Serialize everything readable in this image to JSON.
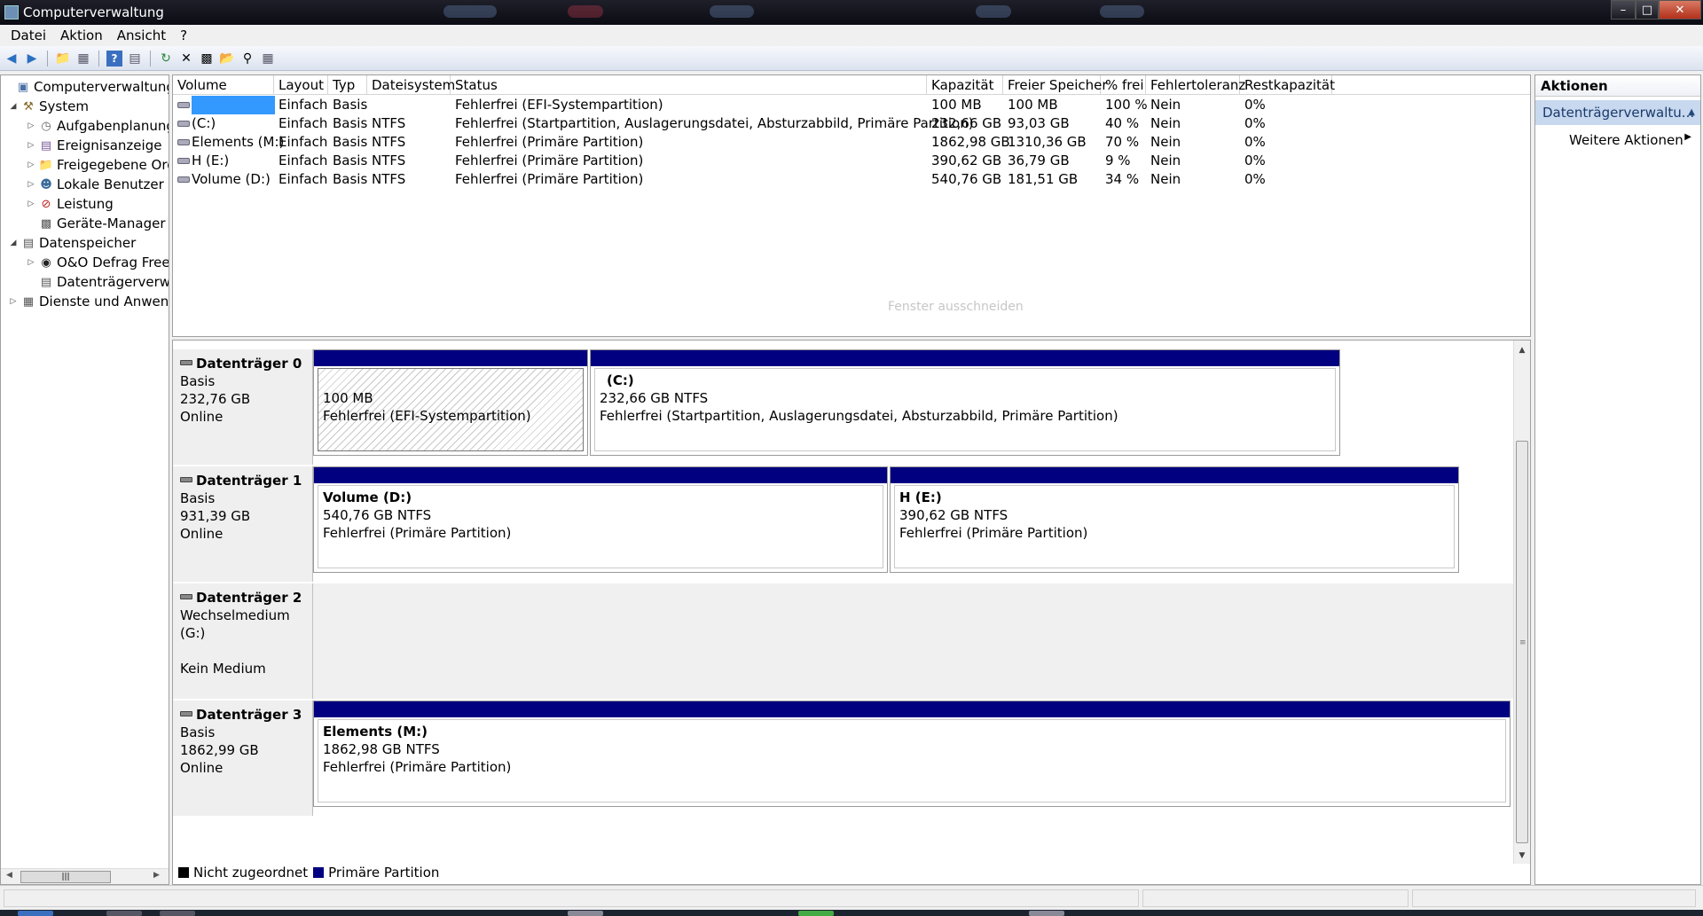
{
  "window": {
    "title": "Computerverwaltung",
    "controls": {
      "minimize": "–",
      "maximize": "□",
      "close": "✕"
    }
  },
  "menu": {
    "items": [
      "Datei",
      "Aktion",
      "Ansicht",
      "?"
    ]
  },
  "toolbar": {
    "icons": [
      "back-arrow-icon",
      "forward-arrow-icon",
      "up-folder-icon",
      "show-hide-tree-icon",
      "help-icon",
      "console-view-icon",
      "refresh-icon",
      "delete-icon",
      "properties-icon",
      "open-icon",
      "search-icon",
      "rescan-icon"
    ]
  },
  "tree": {
    "items": [
      {
        "label": "Computerverwaltung (Lo",
        "level": 0,
        "expander": "",
        "icon": "computer-management-icon"
      },
      {
        "label": "System",
        "level": 1,
        "expander": "◢",
        "icon": "tools-icon"
      },
      {
        "label": "Aufgabenplanung",
        "level": 2,
        "expander": "▷",
        "icon": "clock-icon"
      },
      {
        "label": "Ereignisanzeige",
        "level": 2,
        "expander": "▷",
        "icon": "event-viewer-icon"
      },
      {
        "label": "Freigegebene Ordn",
        "level": 2,
        "expander": "▷",
        "icon": "shared-folder-icon"
      },
      {
        "label": "Lokale Benutzer un",
        "level": 2,
        "expander": "▷",
        "icon": "users-icon"
      },
      {
        "label": "Leistung",
        "level": 2,
        "expander": "▷",
        "icon": "performance-icon"
      },
      {
        "label": "Geräte-Manager",
        "level": 2,
        "expander": "",
        "icon": "device-manager-icon"
      },
      {
        "label": "Datenspeicher",
        "level": 1,
        "expander": "◢",
        "icon": "storage-icon"
      },
      {
        "label": "O&O Defrag Free E",
        "level": 2,
        "expander": "▷",
        "icon": "defrag-icon"
      },
      {
        "label": "Datenträgerverwal",
        "level": 2,
        "expander": "",
        "icon": "disk-management-icon"
      },
      {
        "label": "Dienste und Anwendu",
        "level": 1,
        "expander": "▷",
        "icon": "services-icon"
      }
    ]
  },
  "volume_list": {
    "columns": [
      "Volume",
      "Layout",
      "Typ",
      "Dateisystem",
      "Status",
      "Kapazität",
      "Freier Speicher",
      "% frei",
      "Fehlertoleranz",
      "Restkapazität"
    ],
    "rows": [
      [
        "",
        "Einfach",
        "Basis",
        "",
        "Fehlerfrei (EFI-Systempartition)",
        "100 MB",
        "100 MB",
        "100 %",
        "Nein",
        "0%"
      ],
      [
        "(C:)",
        "Einfach",
        "Basis",
        "NTFS",
        "Fehlerfrei (Startpartition, Auslagerungsdatei, Absturzabbild, Primäre Partition)",
        "232,66 GB",
        "93,03 GB",
        "40 %",
        "Nein",
        "0%"
      ],
      [
        "Elements (M:)",
        "Einfach",
        "Basis",
        "NTFS",
        "Fehlerfrei (Primäre Partition)",
        "1862,98 GB",
        "1310,36 GB",
        "70 %",
        "Nein",
        "0%"
      ],
      [
        "H (E:)",
        "Einfach",
        "Basis",
        "NTFS",
        "Fehlerfrei (Primäre Partition)",
        "390,62 GB",
        "36,79 GB",
        "9 %",
        "Nein",
        "0%"
      ],
      [
        "Volume (D:)",
        "Einfach",
        "Basis",
        "NTFS",
        "Fehlerfrei (Primäre Partition)",
        "540,76 GB",
        "181,51 GB",
        "34 %",
        "Nein",
        "0%"
      ]
    ],
    "overlay_text": "Fenster ausschneiden"
  },
  "disks": [
    {
      "name": "Datenträger 0",
      "type": "Basis",
      "size": "232,76 GB",
      "state": "Online",
      "partitions": [
        {
          "name": "",
          "size": "100 MB",
          "status": "Fehlerfrei (EFI-Systempartition)",
          "hatched": true
        },
        {
          "name": "(C:)",
          "size": "232,66 GB NTFS",
          "status": "Fehlerfrei (Startpartition, Auslagerungsdatei, Absturzabbild, Primäre Partition)",
          "hatched": false
        }
      ]
    },
    {
      "name": "Datenträger 1",
      "type": "Basis",
      "size": "931,39 GB",
      "state": "Online",
      "partitions": [
        {
          "name": "Volume  (D:)",
          "size": "540,76 GB NTFS",
          "status": "Fehlerfrei (Primäre Partition)",
          "hatched": false
        },
        {
          "name": "H  (E:)",
          "size": "390,62 GB NTFS",
          "status": "Fehlerfrei (Primäre Partition)",
          "hatched": false
        }
      ]
    },
    {
      "name": "Datenträger 2",
      "type": "Wechselmedium (G:)",
      "size": "",
      "state": "Kein Medium",
      "partitions": []
    },
    {
      "name": "Datenträger 3",
      "type": "Basis",
      "size": "1862,99 GB",
      "state": "Online",
      "partitions": [
        {
          "name": "Elements  (M:)",
          "size": "1862,98 GB NTFS",
          "status": "Fehlerfrei (Primäre Partition)",
          "hatched": false
        }
      ]
    }
  ],
  "legend": [
    {
      "label": "Nicht zugeordnet",
      "color": "#000000"
    },
    {
      "label": "Primäre Partition",
      "color": "#000080"
    }
  ],
  "actions": {
    "title": "Aktionen",
    "section": "Datenträgerverwaltu...",
    "more": "Weitere Aktionen"
  },
  "colors": {
    "primary_partition": "#000080",
    "selection": "#3399ff",
    "action_header": "#c7d8ef"
  }
}
